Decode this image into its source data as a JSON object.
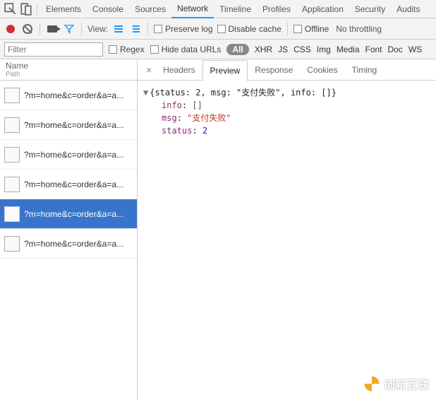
{
  "tabs": {
    "items": [
      "Elements",
      "Console",
      "Sources",
      "Network",
      "Timeline",
      "Profiles",
      "Application",
      "Security",
      "Audits"
    ],
    "active_index": 3
  },
  "filter_bar": {
    "view_label": "View:",
    "preserve_log": "Preserve log",
    "disable_cache": "Disable cache",
    "offline": "Offline",
    "throttling": "No throttling"
  },
  "filter_row2": {
    "filter_placeholder": "Filter",
    "regex": "Regex",
    "hide_data_urls": "Hide data URLs",
    "all_label": "All",
    "types": [
      "XHR",
      "JS",
      "CSS",
      "Img",
      "Media",
      "Font",
      "Doc",
      "WS"
    ]
  },
  "left_header": {
    "name": "Name",
    "path": "Path"
  },
  "requests": [
    {
      "label": "?m=home&c=order&a=a...",
      "selected": false
    },
    {
      "label": "?m=home&c=order&a=a...",
      "selected": false
    },
    {
      "label": "?m=home&c=order&a=a...",
      "selected": false
    },
    {
      "label": "?m=home&c=order&a=a...",
      "selected": false
    },
    {
      "label": "?m=home&c=order&a=a...",
      "selected": true
    },
    {
      "label": "?m=home&c=order&a=a...",
      "selected": false
    }
  ],
  "right_tabs": {
    "items": [
      "Headers",
      "Preview",
      "Response",
      "Cookies",
      "Timing"
    ],
    "active_index": 1
  },
  "preview": {
    "summary": "{status: 2, msg: \"支付失败\", info: []}",
    "info_key": "info",
    "info_val": "[]",
    "msg_key": "msg",
    "msg_val": "\"支付失败\"",
    "status_key": "status",
    "status_val": "2"
  },
  "logo_text": "创新互联"
}
